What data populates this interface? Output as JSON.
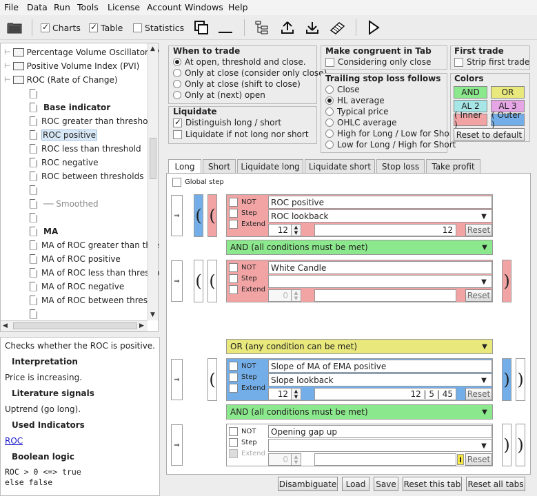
{
  "menu": [
    "File",
    "Data",
    "Run",
    "Tools",
    "License",
    "Account",
    "Windows",
    "Help"
  ],
  "toolbar": {
    "charts": "Charts",
    "table": "Table",
    "statistics": "Statistics"
  },
  "tree": {
    "items": [
      {
        "label": "Percentage Volume Oscillator (P",
        "type": "folder"
      },
      {
        "label": "Positive Volume Index (PVI)",
        "type": "folder"
      },
      {
        "label": "ROC (Rate of Change)",
        "type": "folder"
      },
      {
        "label": "",
        "type": "page"
      },
      {
        "label": "Base indicator",
        "type": "header"
      },
      {
        "label": "ROC greater than threshold",
        "type": "page"
      },
      {
        "label": "ROC positive",
        "type": "page",
        "selected": true
      },
      {
        "label": "ROC less than threshold",
        "type": "page"
      },
      {
        "label": "ROC negative",
        "type": "page"
      },
      {
        "label": "ROC between thresholds",
        "type": "page"
      },
      {
        "label": "",
        "type": "page"
      },
      {
        "label": "── Smoothed",
        "type": "muted"
      },
      {
        "label": "",
        "type": "page"
      },
      {
        "label": "MA",
        "type": "header"
      },
      {
        "label": "MA of ROC greater than thre",
        "type": "page"
      },
      {
        "label": "MA of ROC positive",
        "type": "page"
      },
      {
        "label": "MA of ROC less than thresho",
        "type": "page"
      },
      {
        "label": "MA of ROC negative",
        "type": "page"
      },
      {
        "label": "MA of ROC between thresho",
        "type": "page"
      },
      {
        "label": "",
        "type": "page"
      }
    ]
  },
  "description": {
    "summary": "Checks whether the ROC is positive.",
    "interpretation_h": "Interpretation",
    "interpretation": "Price is increasing.",
    "literature_h": "Literature signals",
    "literature": "Uptrend (go long).",
    "used_h": "Used Indicators",
    "used_link": "ROC",
    "logic_h": "Boolean logic",
    "logic1": "ROC > 0 <=> true",
    "logic2": "else false"
  },
  "when_to_trade": {
    "title": "When to trade",
    "options": [
      "At open, threshold and close.",
      "Only at close (consider only close)",
      "Only at close (shift to close)",
      "Only at (next) open"
    ],
    "selected": 0
  },
  "liquidate": {
    "title": "Liquidate",
    "opt1": "Distinguish long / short",
    "opt2": "Liquidate if not long nor short"
  },
  "congruent": {
    "title": "Make congruent in Tab",
    "opt": "Considering only close"
  },
  "trailing": {
    "title": "Trailing stop loss follows",
    "options": [
      "Close",
      "HL average",
      "Typical price",
      "OHLC average",
      "High for Long / Low for Short",
      "Low for Long / High for Short"
    ],
    "selected": 1
  },
  "first_trade": {
    "title": "First trade",
    "opt": "Strip first trade"
  },
  "colors": {
    "title": "Colors",
    "and": "AND",
    "or": "OR",
    "al2": "AL 2",
    "al3": "AL 3",
    "inner": "( Inner )",
    "outer": "( Outer )",
    "reset": "Reset to default",
    "c_and": "#8ce88c",
    "c_or": "#e8e87c",
    "c_al2": "#a6e6e6",
    "c_al3": "#e6a6e6",
    "c_inner": "#f2a4a4",
    "c_outer": "#73aee8"
  },
  "tabs": [
    "Long",
    "Short",
    "Liquidate long",
    "Liquidate short",
    "Stop loss",
    "Take profit"
  ],
  "global_step": "Global step",
  "blocks": {
    "b1": {
      "not": "NOT",
      "step": "Step",
      "extend": "Extend",
      "name": "ROC positive",
      "param": "ROC lookback",
      "spin": "12",
      "value": "12",
      "reset": "Reset"
    },
    "link1": "AND   (all conditions must be met)",
    "b2": {
      "not": "NOT",
      "step": "Step",
      "extend": "Extend",
      "name": "White Candle",
      "param": "",
      "spin": "0",
      "value": "",
      "reset": "Reset"
    },
    "link2": "OR   (any condition can be met)",
    "b3": {
      "not": "NOT",
      "step": "Step",
      "extend": "Extend",
      "name": "Slope of MA of EMA positive",
      "param": "Slope lookback",
      "spin": "12",
      "value": "12  |  5  |  45",
      "reset": "Reset"
    },
    "link3": "AND   (all conditions must be met)",
    "b4": {
      "not": "NOT",
      "step": "Step",
      "extend": "Extend",
      "name": "Opening gap up",
      "param": "",
      "spin": "0",
      "value": "",
      "reset": "Reset",
      "info": "i"
    }
  },
  "bottom": {
    "disambiguate": "Disambiguate",
    "load": "Load",
    "save": "Save",
    "reset_tab": "Reset this tab",
    "reset_all": "Reset all tabs"
  }
}
